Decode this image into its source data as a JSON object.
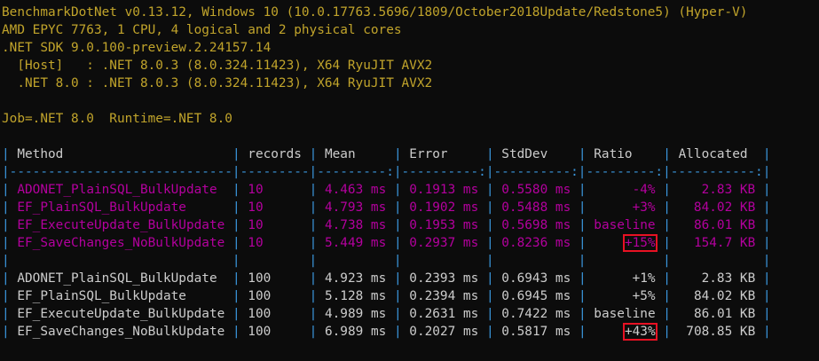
{
  "header": [
    "BenchmarkDotNet v0.13.12, Windows 10 (10.0.17763.5696/1809/October2018Update/Redstone5) (Hyper-V)",
    "AMD EPYC 7763, 1 CPU, 4 logical and 2 physical cores",
    ".NET SDK 9.0.100-preview.2.24157.14",
    "  [Host]   : .NET 8.0.3 (8.0.324.11423), X64 RyuJIT AVX2",
    "  .NET 8.0 : .NET 8.0.3 (8.0.324.11423), X64 RyuJIT AVX2"
  ],
  "job_line": "Job=.NET 8.0  Runtime=.NET 8.0",
  "table": {
    "columns": [
      "Method",
      "records",
      "Mean",
      "Error",
      "StdDev",
      "Ratio",
      "Allocated"
    ],
    "rows": [
      {
        "method": "ADONET_PlainSQL_BulkUpdate",
        "records": "10",
        "mean": "4.463 ms",
        "error": "0.1913 ms",
        "stddev": "0.5580 ms",
        "ratio": "-4%",
        "allocated": "2.83 KB"
      },
      {
        "method": "EF_PlainSQL_BulkUpdate",
        "records": "10",
        "mean": "4.793 ms",
        "error": "0.1902 ms",
        "stddev": "0.5488 ms",
        "ratio": "+3%",
        "allocated": "84.02 KB"
      },
      {
        "method": "EF_ExecuteUpdate_BulkUpdate",
        "records": "10",
        "mean": "4.738 ms",
        "error": "0.1953 ms",
        "stddev": "0.5698 ms",
        "ratio": "baseline",
        "allocated": "86.01 KB"
      },
      {
        "method": "EF_SaveChanges_NoBulkUpdate",
        "records": "10",
        "mean": "5.449 ms",
        "error": "0.2937 ms",
        "stddev": "0.8236 ms",
        "ratio": "+15%",
        "allocated": "154.7 KB"
      },
      {
        "method": "ADONET_PlainSQL_BulkUpdate",
        "records": "100",
        "mean": "4.923 ms",
        "error": "0.2393 ms",
        "stddev": "0.6943 ms",
        "ratio": "+1%",
        "allocated": "2.83 KB"
      },
      {
        "method": "EF_PlainSQL_BulkUpdate",
        "records": "100",
        "mean": "5.128 ms",
        "error": "0.2394 ms",
        "stddev": "0.6945 ms",
        "ratio": "+5%",
        "allocated": "84.02 KB"
      },
      {
        "method": "EF_ExecuteUpdate_BulkUpdate",
        "records": "100",
        "mean": "4.989 ms",
        "error": "0.2631 ms",
        "stddev": "0.7422 ms",
        "ratio": "baseline",
        "allocated": "86.01 KB"
      },
      {
        "method": "EF_SaveChanges_NoBulkUpdate",
        "records": "100",
        "mean": "6.989 ms",
        "error": "0.2027 ms",
        "stddev": "0.5817 ms",
        "ratio": "+43%",
        "allocated": "708.85 KB"
      }
    ]
  },
  "colors": {
    "background": "#0c0c0c",
    "header_text": "#c1a42b",
    "table_text": "#cccccc",
    "separator": "#3a96dd",
    "group1_text": "#b4009e",
    "highlight_box": "#e81123"
  }
}
